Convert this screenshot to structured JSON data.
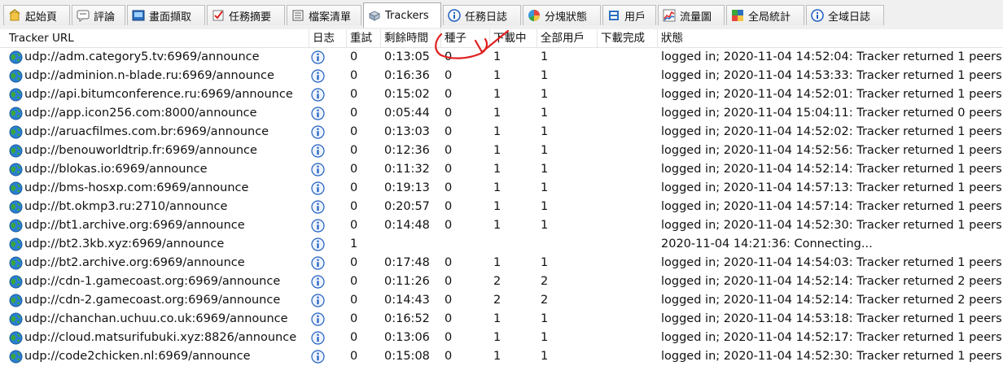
{
  "tabs": [
    {
      "label": "起始頁",
      "icon": "home-icon"
    },
    {
      "label": "評論",
      "icon": "comment-icon"
    },
    {
      "label": "畫面擷取",
      "icon": "screenshot-icon"
    },
    {
      "label": "任務摘要",
      "icon": "task-summary-icon"
    },
    {
      "label": "檔案清單",
      "icon": "file-list-icon"
    },
    {
      "label": "Trackers",
      "icon": "trackers-icon",
      "active": true
    },
    {
      "label": "任務日誌",
      "icon": "task-log-icon"
    },
    {
      "label": "分塊狀態",
      "icon": "piece-status-icon"
    },
    {
      "label": "用戶",
      "icon": "users-icon"
    },
    {
      "label": "流量圖",
      "icon": "traffic-chart-icon"
    },
    {
      "label": "全局統計",
      "icon": "global-stats-icon"
    },
    {
      "label": "全域日誌",
      "icon": "global-log-icon"
    }
  ],
  "columns": [
    "Tracker URL",
    "日志",
    "重試",
    "剩餘時間",
    "種子",
    "下載中",
    "全部用戶",
    "下載完成",
    "狀態"
  ],
  "rows": [
    {
      "url": "udp://adm.category5.tv:6969/announce",
      "retry": "0",
      "remaining": "0:13:05",
      "seeds": "0",
      "downloading": "1",
      "peers": "1",
      "completed": "",
      "status": "logged in; 2020-11-04 14:52:04: Tracker returned 1 peers"
    },
    {
      "url": "udp://adminion.n-blade.ru:6969/announce",
      "retry": "0",
      "remaining": "0:16:36",
      "seeds": "0",
      "downloading": "1",
      "peers": "1",
      "completed": "",
      "status": "logged in; 2020-11-04 14:53:33: Tracker returned 1 peers"
    },
    {
      "url": "udp://api.bitumconference.ru:6969/announce",
      "retry": "0",
      "remaining": "0:15:02",
      "seeds": "0",
      "downloading": "1",
      "peers": "1",
      "completed": "",
      "status": "logged in; 2020-11-04 14:52:01: Tracker returned 1 peers"
    },
    {
      "url": "udp://app.icon256.com:8000/announce",
      "retry": "0",
      "remaining": "0:05:44",
      "seeds": "0",
      "downloading": "1",
      "peers": "1",
      "completed": "",
      "status": "logged in; 2020-11-04 15:04:11: Tracker returned 0 peers"
    },
    {
      "url": "udp://aruacfilmes.com.br:6969/announce",
      "retry": "0",
      "remaining": "0:13:03",
      "seeds": "0",
      "downloading": "1",
      "peers": "1",
      "completed": "",
      "status": "logged in; 2020-11-04 14:52:02: Tracker returned 1 peers"
    },
    {
      "url": "udp://benouworldtrip.fr:6969/announce",
      "retry": "0",
      "remaining": "0:12:36",
      "seeds": "0",
      "downloading": "1",
      "peers": "1",
      "completed": "",
      "status": "logged in; 2020-11-04 14:52:56: Tracker returned 1 peers"
    },
    {
      "url": "udp://blokas.io:6969/announce",
      "retry": "0",
      "remaining": "0:11:32",
      "seeds": "0",
      "downloading": "1",
      "peers": "1",
      "completed": "",
      "status": "logged in; 2020-11-04 14:52:14: Tracker returned 1 peers"
    },
    {
      "url": "udp://bms-hosxp.com:6969/announce",
      "retry": "0",
      "remaining": "0:19:13",
      "seeds": "0",
      "downloading": "1",
      "peers": "1",
      "completed": "",
      "status": "logged in; 2020-11-04 14:57:13: Tracker returned 1 peers"
    },
    {
      "url": "udp://bt.okmp3.ru:2710/announce",
      "retry": "0",
      "remaining": "0:20:57",
      "seeds": "0",
      "downloading": "1",
      "peers": "1",
      "completed": "",
      "status": "logged in; 2020-11-04 14:57:14: Tracker returned 1 peers"
    },
    {
      "url": "udp://bt1.archive.org:6969/announce",
      "retry": "0",
      "remaining": "0:14:48",
      "seeds": "0",
      "downloading": "1",
      "peers": "1",
      "completed": "",
      "status": "logged in; 2020-11-04 14:52:30: Tracker returned 1 peers"
    },
    {
      "url": "udp://bt2.3kb.xyz:6969/announce",
      "retry": "1",
      "remaining": "",
      "seeds": "",
      "downloading": "",
      "peers": "",
      "completed": "",
      "status": "2020-11-04 14:21:36: Connecting..."
    },
    {
      "url": "udp://bt2.archive.org:6969/announce",
      "retry": "0",
      "remaining": "0:17:48",
      "seeds": "0",
      "downloading": "1",
      "peers": "1",
      "completed": "",
      "status": "logged in; 2020-11-04 14:54:03: Tracker returned 1 peers"
    },
    {
      "url": "udp://cdn-1.gamecoast.org:6969/announce",
      "retry": "0",
      "remaining": "0:11:26",
      "seeds": "0",
      "downloading": "2",
      "peers": "2",
      "completed": "",
      "status": "logged in; 2020-11-04 14:52:14: Tracker returned 2 peers"
    },
    {
      "url": "udp://cdn-2.gamecoast.org:6969/announce",
      "retry": "0",
      "remaining": "0:14:43",
      "seeds": "0",
      "downloading": "2",
      "peers": "2",
      "completed": "",
      "status": "logged in; 2020-11-04 14:52:14: Tracker returned 2 peers"
    },
    {
      "url": "udp://chanchan.uchuu.co.uk:6969/announce",
      "retry": "0",
      "remaining": "0:16:52",
      "seeds": "0",
      "downloading": "1",
      "peers": "1",
      "completed": "",
      "status": "logged in; 2020-11-04 14:53:18: Tracker returned 1 peers"
    },
    {
      "url": "udp://cloud.matsurifubuki.xyz:8826/announce",
      "retry": "0",
      "remaining": "0:13:06",
      "seeds": "0",
      "downloading": "1",
      "peers": "1",
      "completed": "",
      "status": "logged in; 2020-11-04 14:52:17: Tracker returned 1 peers"
    },
    {
      "url": "udp://code2chicken.nl:6969/announce",
      "retry": "0",
      "remaining": "0:15:08",
      "seeds": "0",
      "downloading": "1",
      "peers": "1",
      "completed": "",
      "status": "logged in; 2020-11-04 14:52:30: Tracker returned 1 peers"
    }
  ],
  "colors": {
    "annotation_red": "#e02020",
    "globe_blue": "#2a7fd4",
    "globe_green": "#3aa63a",
    "info_blue": "#1f5fbf"
  }
}
